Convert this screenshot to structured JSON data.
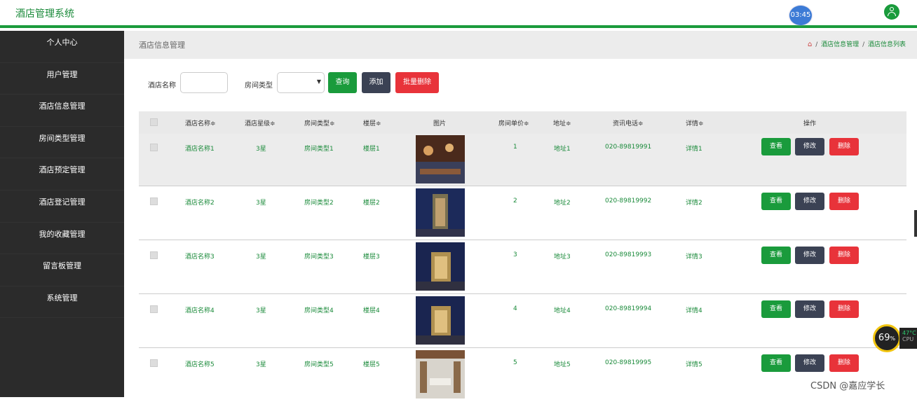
{
  "header": {
    "app_title": "酒店管理系统",
    "clock": "03:45"
  },
  "sidebar": {
    "items": [
      {
        "label": "个人中心"
      },
      {
        "label": "用户管理"
      },
      {
        "label": "酒店信息管理"
      },
      {
        "label": "房间类型管理"
      },
      {
        "label": "酒店预定管理"
      },
      {
        "label": "酒店登记管理"
      },
      {
        "label": "我的收藏管理"
      },
      {
        "label": "留言板管理"
      },
      {
        "label": "系统管理"
      }
    ]
  },
  "breadcrumb": {
    "title": "酒店信息管理",
    "home_icon": "home-icon",
    "path": [
      "酒店信息管理",
      "酒店信息列表"
    ]
  },
  "filter": {
    "hotel_name_label": "酒店名称",
    "hotel_name_value": "",
    "room_type_label": "房间类型",
    "room_type_value": "",
    "query_label": "查询",
    "add_label": "添加",
    "batch_delete_label": "批量删除"
  },
  "table": {
    "headers": [
      "酒店名称≑",
      "酒店星级≑",
      "房间类型≑",
      "楼层≑",
      "图片",
      "房间单价≑",
      "地址≑",
      "资讯电话≑",
      "详情≑",
      "操作"
    ],
    "rows": [
      {
        "name": "酒店名称1",
        "star": "3星",
        "room_type": "房间类型1",
        "floor": "楼层1",
        "price": "1",
        "address": "地址1",
        "phone": "020-89819991",
        "detail": "详情1"
      },
      {
        "name": "酒店名称2",
        "star": "3星",
        "room_type": "房间类型2",
        "floor": "楼层2",
        "price": "2",
        "address": "地址2",
        "phone": "020-89819992",
        "detail": "详情2"
      },
      {
        "name": "酒店名称3",
        "star": "3星",
        "room_type": "房间类型3",
        "floor": "楼层3",
        "price": "3",
        "address": "地址3",
        "phone": "020-89819993",
        "detail": "详情3"
      },
      {
        "name": "酒店名称4",
        "star": "3星",
        "room_type": "房间类型4",
        "floor": "楼层4",
        "price": "4",
        "address": "地址4",
        "phone": "020-89819994",
        "detail": "详情4"
      },
      {
        "name": "酒店名称5",
        "star": "3星",
        "room_type": "房间类型5",
        "floor": "楼层5",
        "price": "5",
        "address": "地址5",
        "phone": "020-89819995",
        "detail": "详情5"
      }
    ],
    "actions": {
      "view": "查看",
      "edit": "修改",
      "delete": "删除"
    }
  },
  "overlay": {
    "cpu_percent": "69",
    "percent_sign": "%",
    "temp": "47°C",
    "cpu_label": "CPU"
  },
  "watermark": "CSDN @嘉应学长",
  "colors": {
    "brand_green": "#1a9b3c",
    "dark_button": "#3b4254",
    "danger_red": "#e8333a",
    "sidebar_bg": "#2b2b2b"
  }
}
